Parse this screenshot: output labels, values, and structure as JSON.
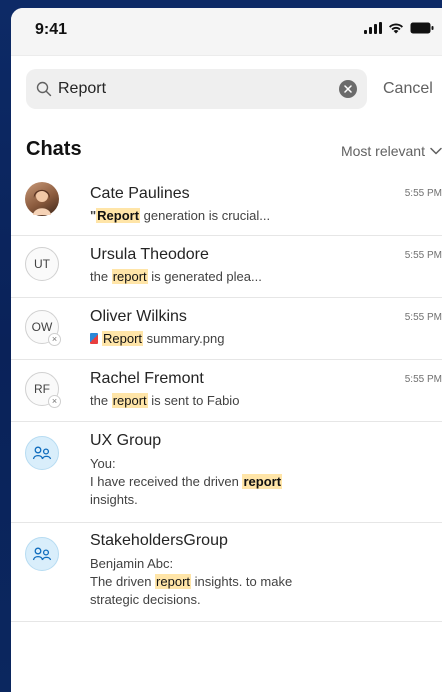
{
  "status_bar": {
    "time": "9:41"
  },
  "search": {
    "value": "Report",
    "cancel_label": "Cancel"
  },
  "section": {
    "title": "Chats",
    "sort_label": "Most relevant"
  },
  "chats": [
    {
      "name": "Cate Paulines",
      "time": "5:55 PM",
      "pre": "\"",
      "highlight": "Report",
      "post": " generation is crucial..."
    },
    {
      "name": "Ursula Theodore",
      "initials": "UT",
      "time": "5:55 PM",
      "pre": "the ",
      "highlight": "report",
      "post": " is generated plea..."
    },
    {
      "name": "Oliver Wilkins",
      "initials": "OW",
      "time": "5:55 PM",
      "pre": "",
      "highlight": "Report",
      "post": " summary.png"
    },
    {
      "name": "Rachel Fremont",
      "initials": "RF",
      "time": "5:55 PM",
      "pre": "the ",
      "highlight": "report",
      "post": " is sent to Fabio"
    }
  ],
  "groups": [
    {
      "name": "UX Group",
      "sender": "You:",
      "line1_pre": "I have received the driven ",
      "highlight": "report",
      "line1_post": "",
      "line2": "insights."
    },
    {
      "name": "StakeholdersGroup",
      "sender": "Benjamin Abc:",
      "line1_pre": "The driven ",
      "highlight": "report",
      "line1_post": " insights.  to make",
      "line2": "strategic decisions."
    }
  ]
}
